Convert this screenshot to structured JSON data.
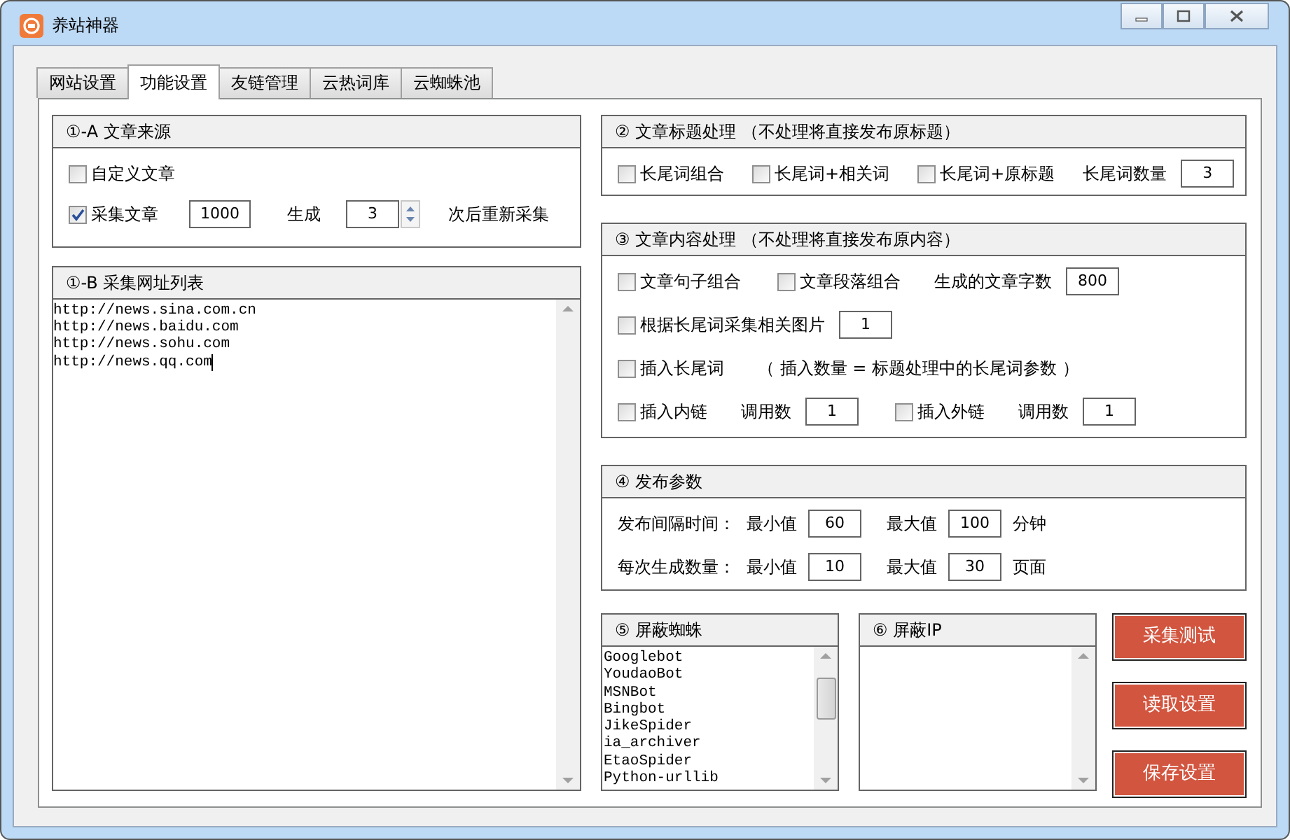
{
  "window": {
    "title": "养站神器"
  },
  "tabs": [
    {
      "label": "网站设置",
      "selected": false
    },
    {
      "label": "功能设置",
      "selected": true
    },
    {
      "label": "友链管理",
      "selected": false
    },
    {
      "label": "云热词库",
      "selected": false
    },
    {
      "label": "云蜘蛛池",
      "selected": false
    }
  ],
  "source_group": {
    "title": "①-A 文章来源",
    "custom_article": {
      "label": "自定义文章",
      "checked": false
    },
    "collect": {
      "label": "采集文章",
      "checked": true,
      "count": "1000",
      "generate_label": "生成",
      "times": "3",
      "suffix": "次后重新采集"
    }
  },
  "url_list": {
    "title": "①-B 采集网址列表",
    "lines": [
      "http://news.sina.com.cn",
      "http://news.baidu.com",
      "http://news.sohu.com",
      "http://news.qq.com"
    ]
  },
  "title_group": {
    "title": "② 文章标题处理 （不处理将直接发布原标题）",
    "rows": [
      {
        "items": [
          {
            "kind": "checkbox",
            "label": "长尾词组合",
            "checked": false
          },
          {
            "kind": "checkbox",
            "label": "长尾词+相关词",
            "checked": false
          },
          {
            "kind": "checkbox",
            "label": "长尾词+原标题",
            "checked": false
          },
          {
            "kind": "text",
            "label": "长尾词数量"
          },
          {
            "kind": "field",
            "value": "3"
          }
        ]
      }
    ]
  },
  "content_group": {
    "title": "③ 文章内容处理 （不处理将直接发布原内容）",
    "rows": [
      {
        "items": [
          {
            "kind": "checkbox",
            "label": "文章句子组合",
            "checked": false
          },
          {
            "kind": "checkbox",
            "label": "文章段落组合",
            "checked": false
          },
          {
            "kind": "text",
            "label": "生成的文章字数"
          },
          {
            "kind": "field",
            "value": "800"
          }
        ]
      },
      {
        "items": [
          {
            "kind": "checkbox",
            "label": "根据长尾词采集相关图片",
            "checked": false
          },
          {
            "kind": "field",
            "value": "1"
          }
        ]
      },
      {
        "items": [
          {
            "kind": "checkbox",
            "label": "插入长尾词",
            "checked": false
          },
          {
            "kind": "text",
            "label": "（ 插入数量 = 标题处理中的长尾词参数 ）"
          }
        ]
      },
      {
        "items": [
          {
            "kind": "checkbox",
            "label": "插入内链",
            "checked": false
          },
          {
            "kind": "text",
            "label": "调用数"
          },
          {
            "kind": "field",
            "value": "1"
          },
          {
            "kind": "checkbox",
            "label": "插入外链",
            "checked": false
          },
          {
            "kind": "text",
            "label": "调用数"
          },
          {
            "kind": "field",
            "value": "1"
          }
        ]
      }
    ]
  },
  "publish_group": {
    "title": "④ 发布参数",
    "rows": [
      {
        "label": "发布间隔时间：",
        "min_label": "最小值",
        "min": "60",
        "max_label": "最大值",
        "max": "100",
        "unit": "分钟"
      },
      {
        "label": "每次生成数量：",
        "min_label": "最小值",
        "min": "10",
        "max_label": "最大值",
        "max": "30",
        "unit": "页面"
      }
    ]
  },
  "spider_block": {
    "title": "⑤ 屏蔽蜘蛛",
    "lines": [
      "Googlebot",
      "YoudaoBot",
      "MSNBot",
      "Bingbot",
      "JikeSpider",
      "ia_archiver",
      "EtaoSpider",
      "Python-urllib"
    ]
  },
  "ip_block": {
    "title": "⑥ 屏蔽IP"
  },
  "buttons": [
    "采集测试",
    "读取设置",
    "保存设置"
  ]
}
